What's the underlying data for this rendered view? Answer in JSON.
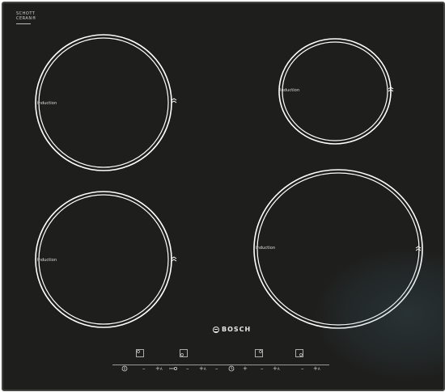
{
  "brandmark": {
    "line1": "SCHOTT",
    "line2": "CERAN®"
  },
  "zones": [
    {
      "id": "front-left",
      "label": "Induction"
    },
    {
      "id": "rear-right",
      "label": "Induction"
    },
    {
      "id": "rear-left",
      "label": "Induction"
    },
    {
      "id": "front-right",
      "label": "Induction"
    }
  ],
  "brand": {
    "name": "BOSCH"
  },
  "controls": {
    "power_icon": "power-icon",
    "lock_icon": "key-lock-icon",
    "timer_icon": "timer-icon",
    "minus": "–",
    "plus": "+",
    "boost": "+",
    "boost_letter": "A",
    "timer_minus": "–",
    "timer_plus": "+"
  },
  "colors": {
    "glass": "#1e1e1c",
    "ring": "#ffffff",
    "text": "#e0e0e0"
  }
}
